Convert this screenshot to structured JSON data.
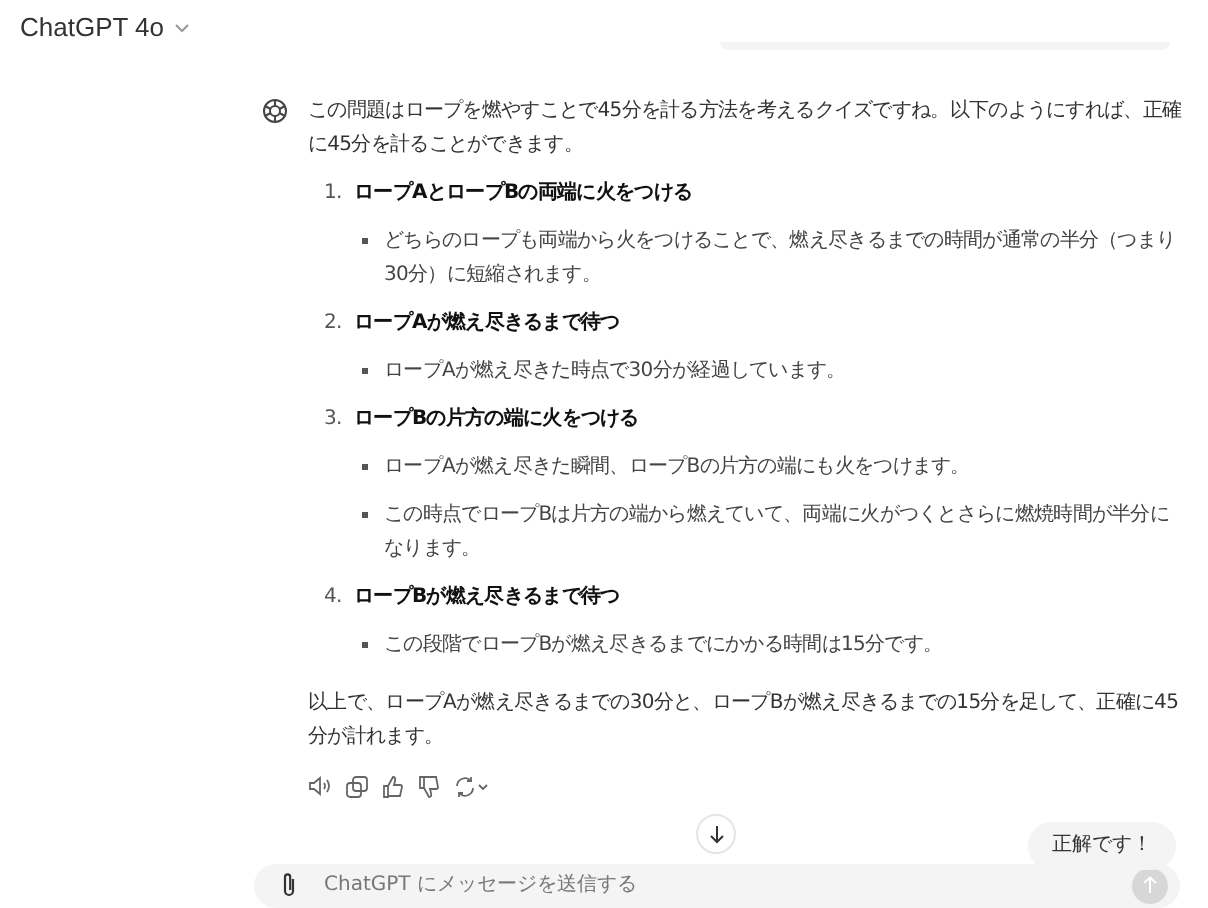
{
  "header": {
    "title": "ChatGPT 4o"
  },
  "assistant": {
    "intro": "この問題はロープを燃やすことで45分を計る方法を考えるクイズですね。以下のようにすれば、正確に45分を計ることができます。",
    "steps": [
      {
        "number": "1.",
        "title": "ロープAとロープBの両端に火をつける",
        "bullets": [
          "どちらのロープも両端から火をつけることで、燃え尽きるまでの時間が通常の半分（つまり30分）に短縮されます。"
        ]
      },
      {
        "number": "2.",
        "title": "ロープAが燃え尽きるまで待つ",
        "bullets": [
          "ロープAが燃え尽きた時点で30分が経過しています。"
        ]
      },
      {
        "number": "3.",
        "title": "ロープBの片方の端に火をつける",
        "bullets": [
          "ロープAが燃え尽きた瞬間、ロープBの片方の端にも火をつけます。",
          "この時点でロープBは片方の端から燃えていて、両端に火がつくとさらに燃焼時間が半分になります。"
        ]
      },
      {
        "number": "4.",
        "title": "ロープBが燃え尽きるまで待つ",
        "bullets": [
          "この段階でロープBが燃え尽きるまでにかかる時間は15分です。"
        ]
      }
    ],
    "conclusion": "以上で、ロープAが燃え尽きるまでの30分と、ロープBが燃え尽きるまでの15分を足して、正確に45分が計れます。"
  },
  "user_message": "正解です！",
  "composer": {
    "placeholder": "ChatGPT にメッセージを送信する"
  }
}
